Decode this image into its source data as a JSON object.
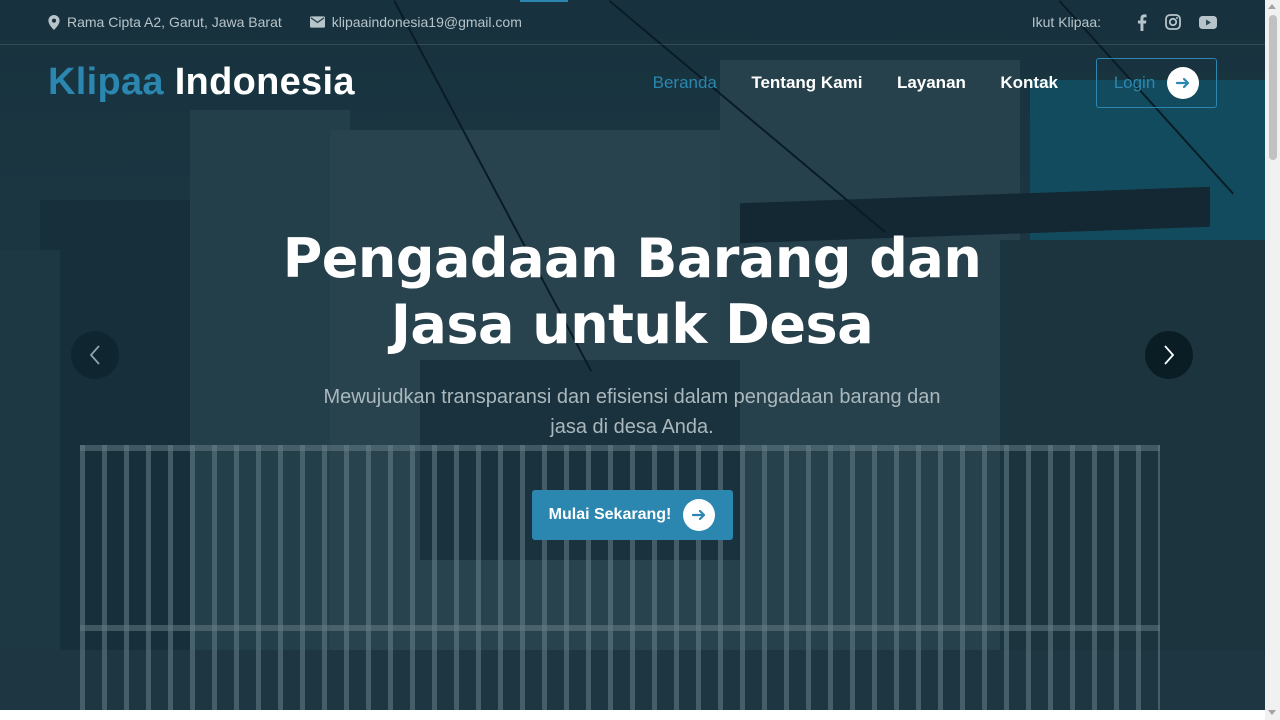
{
  "topbar": {
    "address": "Rama Cipta A2, Garut, Jawa Barat",
    "email": "klipaaindonesia19@gmail.com",
    "follow_label": "Ikut Klipaa:",
    "social": [
      {
        "icon": "facebook-icon"
      },
      {
        "icon": "instagram-icon"
      },
      {
        "icon": "youtube-icon"
      }
    ]
  },
  "brand": {
    "part1": "Klipaa",
    "part2": "Indonesia"
  },
  "nav": {
    "items": [
      {
        "label": "Beranda",
        "active": true
      },
      {
        "label": "Tentang Kami",
        "active": false
      },
      {
        "label": "Layanan",
        "active": false
      },
      {
        "label": "Kontak",
        "active": false
      }
    ],
    "login_label": "Login"
  },
  "hero": {
    "title_line1": "Pengadaan Barang dan",
    "title_line2": "Jasa untuk Desa",
    "subtitle": "Mewujudkan transparansi dan efisiensi dalam pengadaan barang dan jasa di desa Anda.",
    "cta_label": "Mulai Sekarang!"
  },
  "colors": {
    "accent": "#2b86b0",
    "text_light": "#ffffff",
    "muted": "#b7c4c9"
  }
}
